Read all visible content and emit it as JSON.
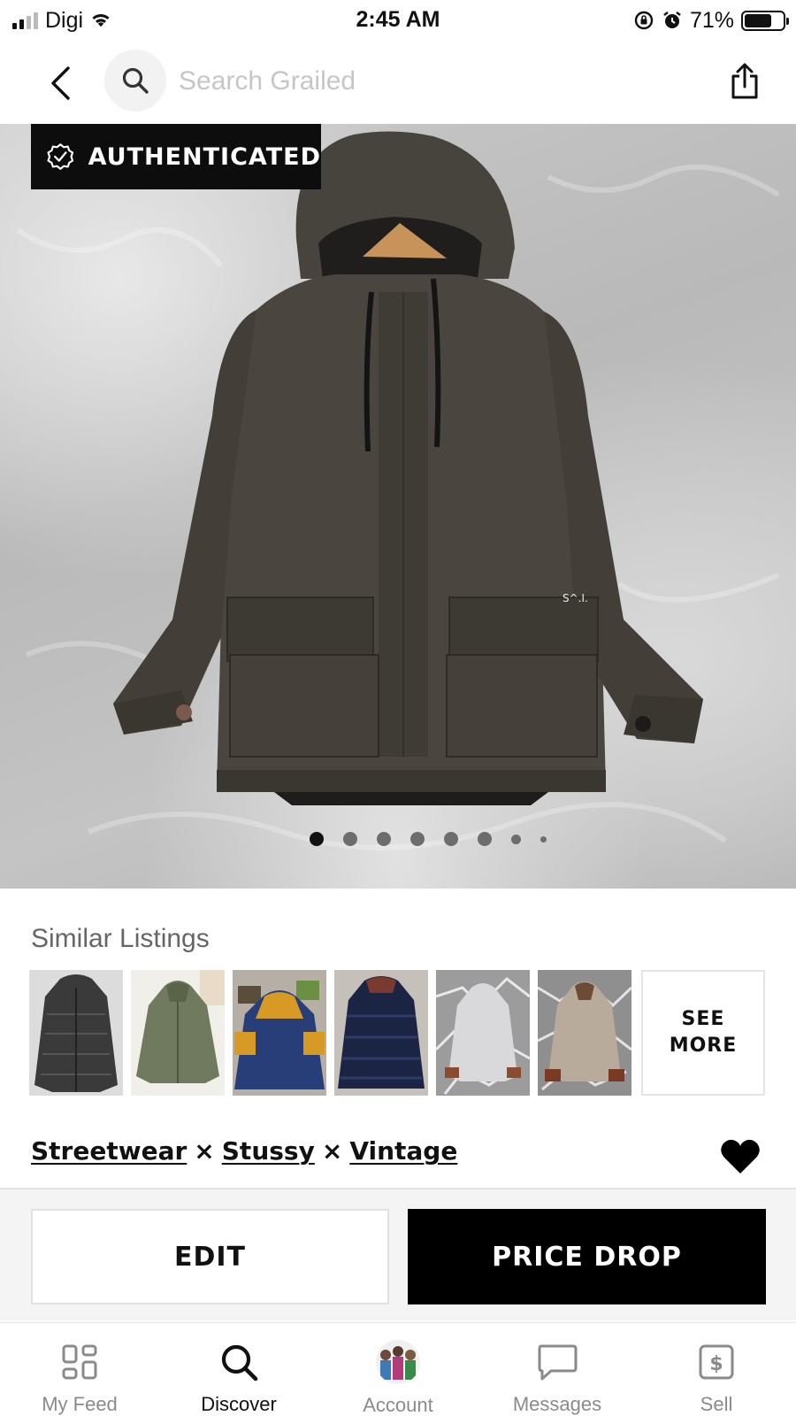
{
  "status_bar": {
    "carrier": "Digi",
    "time": "2:45 AM",
    "battery_percent": "71%",
    "battery_level": 0.71,
    "icons": [
      "signal-icon",
      "wifi-icon",
      "rotation-lock-icon",
      "alarm-icon",
      "battery-icon"
    ]
  },
  "nav": {
    "search_placeholder": "Search Grailed",
    "back_icon": "chevron-left-icon",
    "search_icon": "search-icon",
    "share_icon": "share-icon"
  },
  "hero": {
    "badge_label": "AUTHENTICATED",
    "badge_icon": "verified-badge-icon",
    "jacket_tag_text": "S^.I.",
    "image_count": 8,
    "active_image_index": 0
  },
  "similar": {
    "title": "Similar Listings",
    "see_more_label": "SEE\nMORE",
    "items": [
      {
        "name": "black-puffer-jacket",
        "color": "#3a3a3a"
      },
      {
        "name": "green-hooded-jacket",
        "color": "#6f7a5e"
      },
      {
        "name": "navy-yellow-jacket",
        "color": "#283e78"
      },
      {
        "name": "navy-puffer-jacket",
        "color": "#1c2444"
      },
      {
        "name": "white-hooded-jacket",
        "color": "#d9d9dc"
      },
      {
        "name": "beige-hooded-jacket",
        "color": "#b8ab9c"
      }
    ]
  },
  "tags": {
    "items": [
      "Streetwear",
      "Stussy",
      "Vintage"
    ],
    "separator": "×",
    "favorite_icon": "heart-icon"
  },
  "actions": {
    "edit_label": "EDIT",
    "price_drop_label": "PRICE DROP"
  },
  "tab_bar": {
    "active": "Discover",
    "tabs": [
      {
        "label": "My Feed",
        "icon": "grid-icon"
      },
      {
        "label": "Discover",
        "icon": "search-icon"
      },
      {
        "label": "Account",
        "icon": "avatar"
      },
      {
        "label": "Messages",
        "icon": "message-icon"
      },
      {
        "label": "Sell",
        "icon": "dollar-tag-icon"
      }
    ]
  },
  "colors": {
    "primary": "#000000",
    "background": "#ffffff",
    "action_bar_bg": "#f4f4f4",
    "muted_text": "#8a8a8a",
    "placeholder": "#c6c6c6"
  }
}
